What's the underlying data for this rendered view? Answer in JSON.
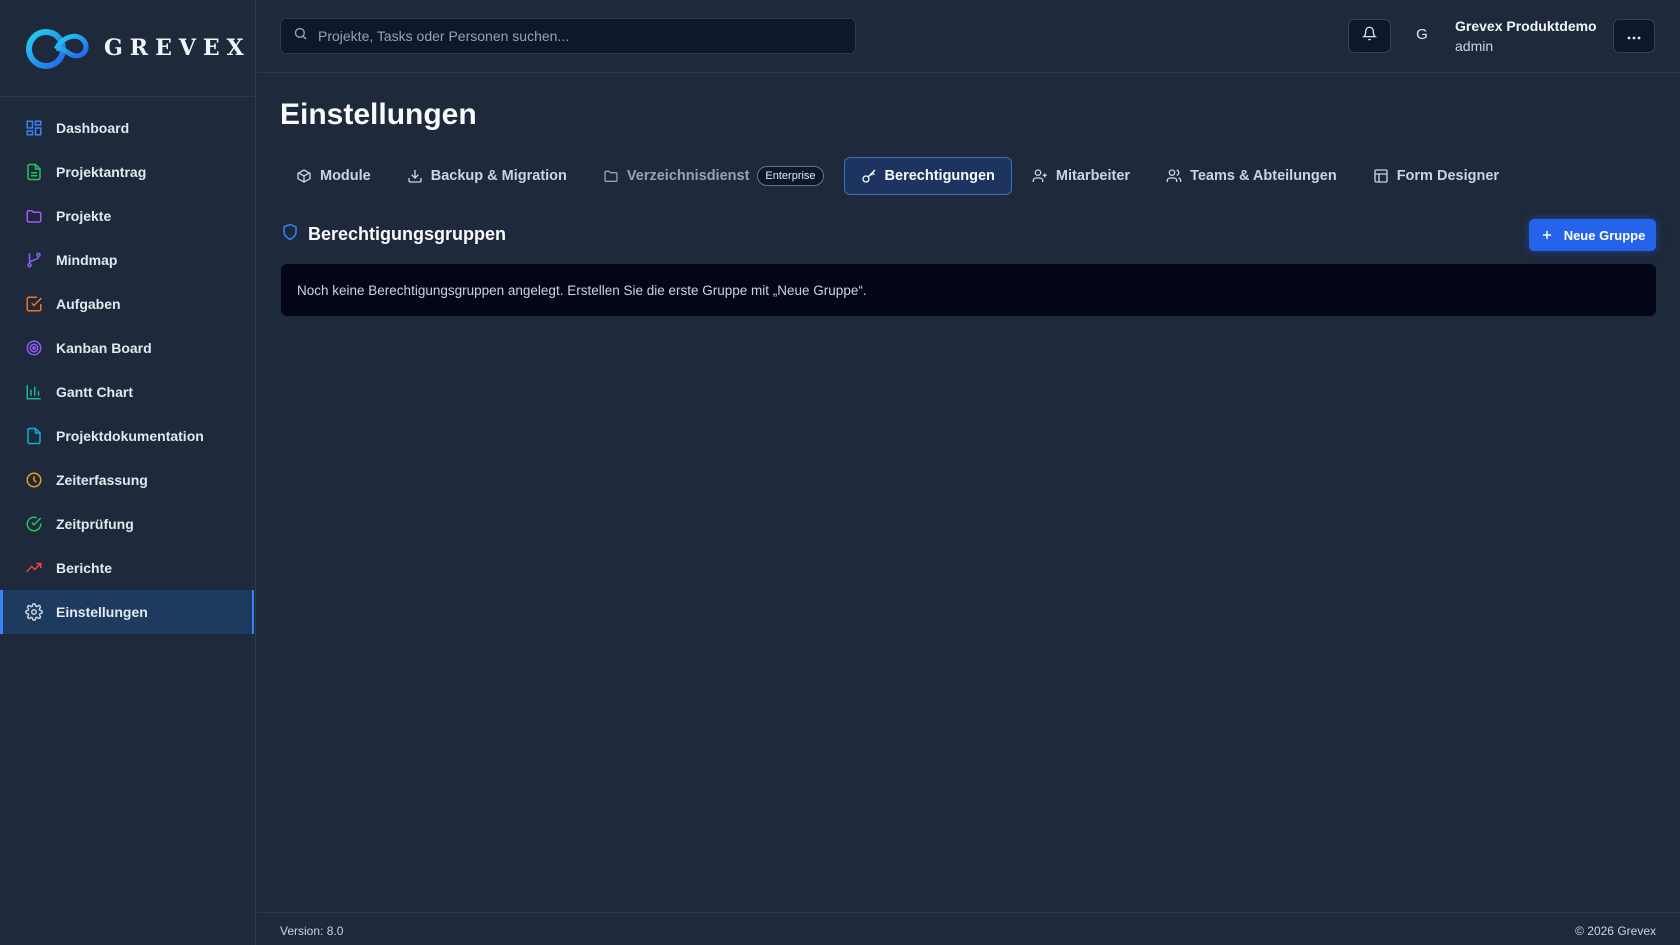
{
  "brand": {
    "name": "GREVEX"
  },
  "sidebar": {
    "items": [
      {
        "label": "Dashboard",
        "icon": "dashboard-icon",
        "color": "#3b82f6"
      },
      {
        "label": "Projektantrag",
        "icon": "file-text-icon",
        "color": "#22c55e"
      },
      {
        "label": "Projekte",
        "icon": "folder-icon",
        "color": "#a855f7"
      },
      {
        "label": "Mindmap",
        "icon": "git-branch-icon",
        "color": "#8b5cf6"
      },
      {
        "label": "Aufgaben",
        "icon": "check-square-icon",
        "color": "#f97316"
      },
      {
        "label": "Kanban Board",
        "icon": "target-icon",
        "color": "#8b5cf6"
      },
      {
        "label": "Gantt Chart",
        "icon": "bar-chart-icon",
        "color": "#14b8a6"
      },
      {
        "label": "Projektdokumentation",
        "icon": "document-icon",
        "color": "#06b6d4"
      },
      {
        "label": "Zeiterfassung",
        "icon": "clock-icon",
        "color": "#f59e0b"
      },
      {
        "label": "Zeitprüfung",
        "icon": "check-circle-icon",
        "color": "#22c55e"
      },
      {
        "label": "Berichte",
        "icon": "trending-up-icon",
        "color": "#ef4444"
      },
      {
        "label": "Einstellungen",
        "icon": "gear-icon",
        "color": "#cbd5e1",
        "active": true
      }
    ]
  },
  "header": {
    "search_placeholder": "Projekte, Tasks oder Personen suchen...",
    "avatar_initial": "G",
    "user_name": "Grevex Produktdemo",
    "user_role": "admin"
  },
  "main": {
    "title": "Einstellungen",
    "tabs": [
      {
        "label": "Module",
        "icon": "package-icon"
      },
      {
        "label": "Backup & Migration",
        "icon": "download-icon"
      },
      {
        "label": "Verzeichnisdienst",
        "icon": "folder-icon",
        "badge": "Enterprise",
        "disabled": true
      },
      {
        "label": "Berechtigungen",
        "icon": "key-icon",
        "active": true
      },
      {
        "label": "Mitarbeiter",
        "icon": "user-icon"
      },
      {
        "label": "Teams & Abteilungen",
        "icon": "users-icon"
      },
      {
        "label": "Form Designer",
        "icon": "layout-icon"
      }
    ],
    "section_title": "Berechtigungsgruppen",
    "new_button_label": "Neue Gruppe",
    "empty_message": "Noch keine Berechtigungsgruppen angelegt. Erstellen Sie die erste Gruppe mit „Neue Gruppe“."
  },
  "footer": {
    "version": "Version: 8.0",
    "copyright": "© 2026 Grevex"
  }
}
